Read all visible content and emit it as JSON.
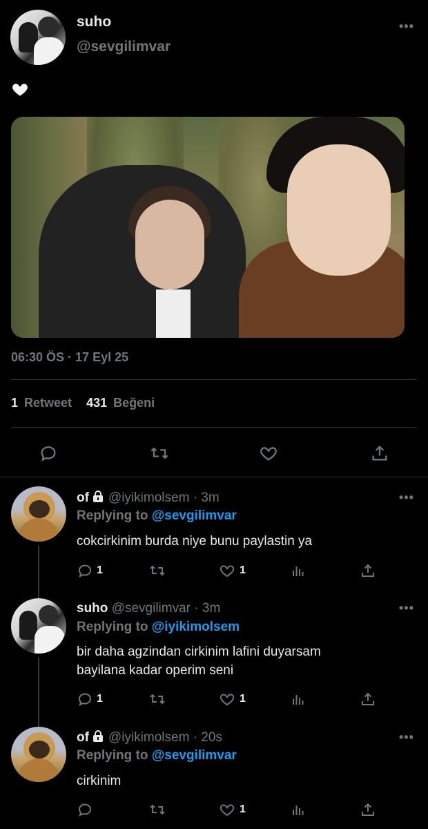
{
  "tweet": {
    "author_name": "suho",
    "author_handle": "@sevgilimvar",
    "text_emoji": "heart",
    "timestamp": "06:30 ÖS · 17 Eyl 25",
    "retweets": {
      "count": "1",
      "label": "Retweet"
    },
    "likes": {
      "count": "431",
      "label": "Beğeni"
    }
  },
  "replies": [
    {
      "name": "of",
      "locked": true,
      "handle": "@iyikimolsem",
      "time": "· 3m",
      "replying_prefix": "Replying to",
      "replying_to": "@sevgilimvar",
      "lines": [
        "cokcirkinim burda niye bunu paylastin ya"
      ],
      "reply_count": "1",
      "like_count": "1"
    },
    {
      "name": "suho",
      "locked": false,
      "handle": "@sevgilimvar",
      "time": "· 3m",
      "replying_prefix": "Replying to",
      "replying_to": "@iyikimolsem",
      "lines": [
        "bir daha agzindan cirkinim lafini duyarsam",
        "bayilana kadar operim seni"
      ],
      "reply_count": "1",
      "like_count": "1"
    },
    {
      "name": "of",
      "locked": true,
      "handle": "@iyikimolsem",
      "time": "· 20s",
      "replying_prefix": "Replying to",
      "replying_to": "@sevgilimvar",
      "lines": [
        "cirkinim"
      ],
      "reply_count": "",
      "like_count": "1"
    }
  ],
  "icons": {
    "reply": "reply-icon",
    "retweet": "retweet-icon",
    "like": "heart-icon",
    "share": "share-icon",
    "analytics": "analytics-icon",
    "more": "more-icon",
    "lock": "lock-icon"
  },
  "colors": {
    "background": "#000000",
    "accent": "#1d9bf0",
    "muted": "#71767b",
    "text": "#e7e9ea"
  }
}
